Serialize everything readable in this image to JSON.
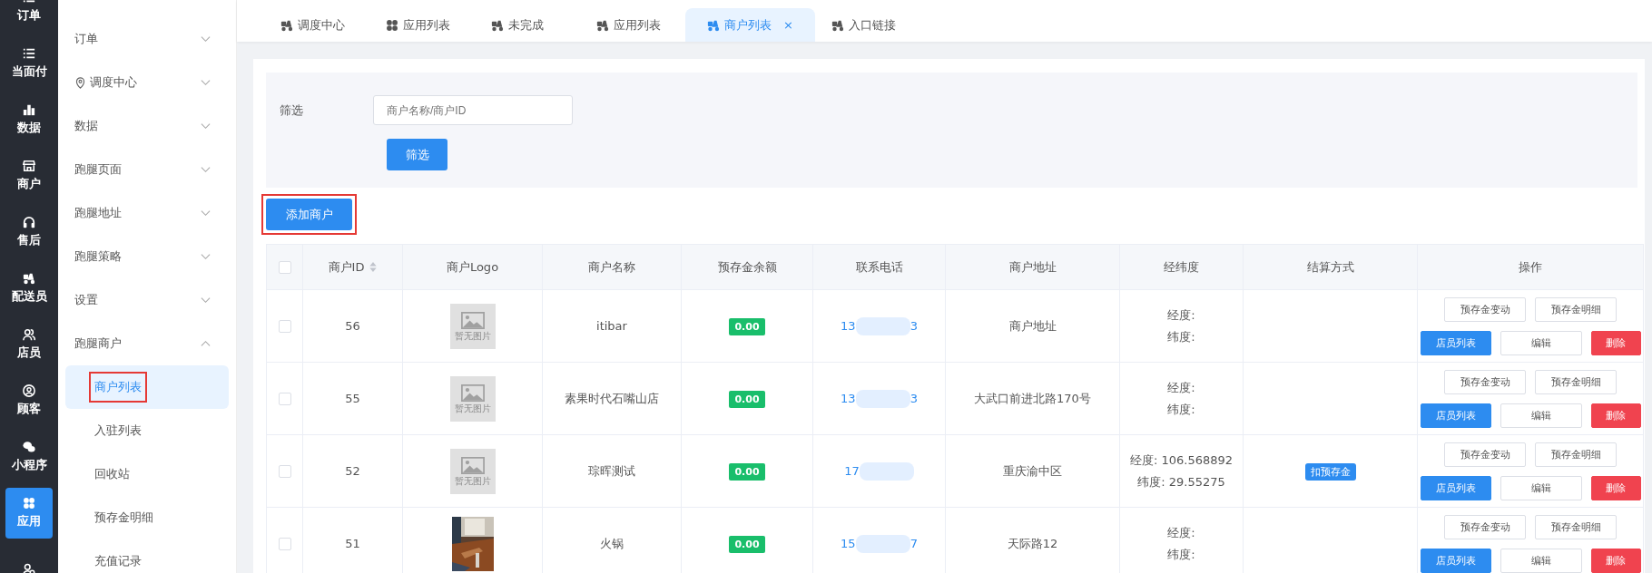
{
  "rail": [
    {
      "label": "订单",
      "selected": false
    },
    {
      "label": "当面付",
      "selected": false
    },
    {
      "label": "数据",
      "selected": false
    },
    {
      "label": "商户",
      "selected": false
    },
    {
      "label": "售后",
      "selected": false
    },
    {
      "label": "配送员",
      "selected": false
    },
    {
      "label": "店员",
      "selected": false
    },
    {
      "label": "顾客",
      "selected": false
    },
    {
      "label": "小程序",
      "selected": false
    },
    {
      "label": "应用",
      "selected": true
    },
    {
      "selected": false
    }
  ],
  "menu": [
    {
      "label": "订单",
      "expanded": false
    },
    {
      "label": "调度中心",
      "expanded": false
    },
    {
      "label": "数据",
      "expanded": false
    },
    {
      "label": "跑腿页面",
      "expanded": false
    },
    {
      "label": "跑腿地址",
      "expanded": false
    },
    {
      "label": "跑腿策略",
      "expanded": false
    },
    {
      "label": "设置",
      "expanded": false
    },
    {
      "label": "跑腿商户",
      "expanded": true,
      "children": [
        {
          "label": "商户列表",
          "selected": true,
          "highlighted": true
        },
        {
          "label": "入驻列表",
          "selected": false,
          "highlighted": false
        },
        {
          "label": "回收站",
          "selected": false,
          "highlighted": false
        },
        {
          "label": "预存金明细",
          "selected": false,
          "highlighted": false
        },
        {
          "label": "充值记录",
          "selected": false,
          "highlighted": false
        }
      ]
    }
  ],
  "tabs": [
    {
      "label": "调度中心",
      "selected": false
    },
    {
      "label": "应用列表",
      "selected": false
    },
    {
      "label": "未完成",
      "selected": false
    },
    {
      "label": "应用列表",
      "selected": false
    },
    {
      "label": "商户列表",
      "selected": true,
      "close": "×"
    },
    {
      "label": "入口链接",
      "selected": false
    }
  ],
  "filter": {
    "label": "筛选",
    "placeholder": "商户名称/商户ID",
    "button": "筛选"
  },
  "add_button": {
    "label": "添加商户",
    "highlighted": true
  },
  "table": {
    "all_checked": false,
    "columns": [
      "商户ID",
      "商户Logo",
      "商户名称",
      "预存金余额",
      "联系电话",
      "商户地址",
      "经纬度",
      "结算方式",
      "操作"
    ],
    "rows": [
      {
        "checked": false,
        "id": "56",
        "logo": {
          "kind": "placeholder",
          "text": "暂无图片"
        },
        "name": "itibar",
        "balance": "0.00",
        "phone_start": "13",
        "phone_end": "3",
        "address": "商户地址",
        "lng": "经度:",
        "lat": "纬度:",
        "actions": [
          {
            "label": "预存金变动",
            "kind": "default"
          },
          {
            "label": "预存金明细",
            "kind": "default"
          },
          {
            "label": "店员列表",
            "kind": "primary"
          },
          {
            "label": "编辑",
            "kind": "default"
          },
          {
            "label": "删除",
            "kind": "danger"
          }
        ]
      },
      {
        "checked": false,
        "id": "55",
        "logo": {
          "kind": "placeholder",
          "text": "暂无图片"
        },
        "name": "素果时代石嘴山店",
        "balance": "0.00",
        "phone_start": "13",
        "phone_end": "3",
        "address": "大武口前进北路170号",
        "lng": "经度:",
        "lat": "纬度:",
        "actions": [
          {
            "label": "预存金变动",
            "kind": "default"
          },
          {
            "label": "预存金明细",
            "kind": "default"
          },
          {
            "label": "店员列表",
            "kind": "primary"
          },
          {
            "label": "编辑",
            "kind": "default"
          },
          {
            "label": "删除",
            "kind": "danger"
          }
        ]
      },
      {
        "checked": false,
        "id": "52",
        "logo": {
          "kind": "placeholder",
          "text": "暂无图片"
        },
        "name": "琮晖测试",
        "balance": "0.00",
        "phone_start": "17",
        "address": "重庆渝中区",
        "lng": "经度: 106.568892",
        "lat": "纬度: 29.55275",
        "settlement": "扣预存金",
        "actions": [
          {
            "label": "预存金变动",
            "kind": "default"
          },
          {
            "label": "预存金明细",
            "kind": "default"
          },
          {
            "label": "店员列表",
            "kind": "primary"
          },
          {
            "label": "编辑",
            "kind": "default"
          },
          {
            "label": "删除",
            "kind": "danger"
          }
        ]
      },
      {
        "checked": false,
        "id": "51",
        "logo": {
          "kind": "picture"
        },
        "name": "火锅",
        "balance": "0.00",
        "phone_start": "15",
        "phone_end": "7",
        "address": "天际路12",
        "lng": "经度:",
        "lat": "纬度:",
        "actions": [
          {
            "label": "预存金变动",
            "kind": "default"
          },
          {
            "label": "预存金明细",
            "kind": "default"
          },
          {
            "label": "店员列表",
            "kind": "primary"
          },
          {
            "label": "编辑",
            "kind": "default"
          },
          {
            "label": "删除",
            "kind": "danger"
          }
        ]
      }
    ]
  }
}
